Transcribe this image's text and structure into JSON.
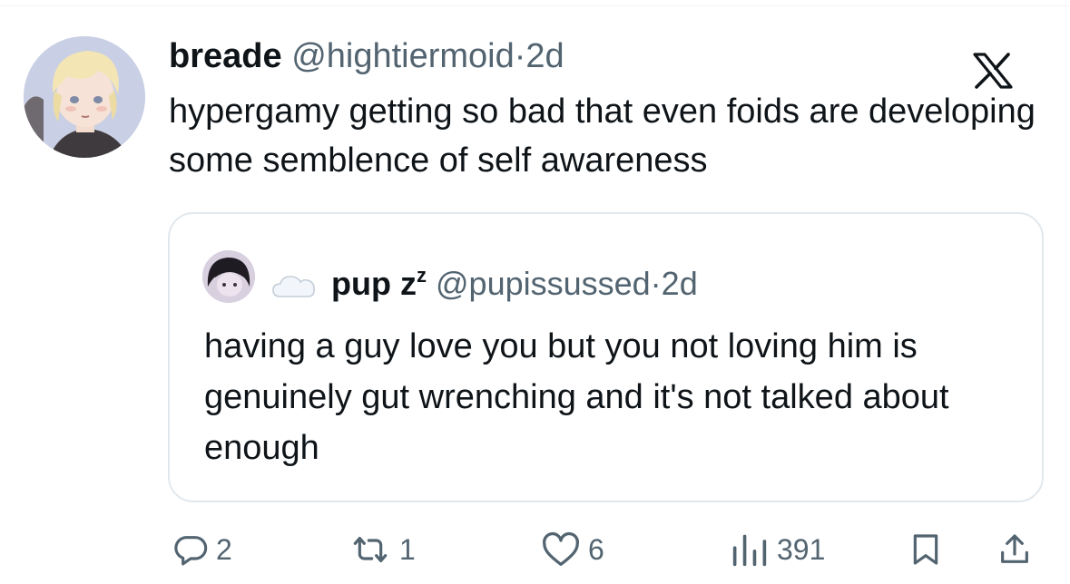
{
  "tweet": {
    "display_name": "breade",
    "handle": "@hightiermoid",
    "separator": "·",
    "time": "2d",
    "text": "hypergamy getting so bad that even foids are developing some semblence of self awareness",
    "logo_icon": "x-logo-icon"
  },
  "quote": {
    "display_name": "pup z",
    "name_sup": "z",
    "handle": "@pupissussed",
    "separator": "·",
    "time": "2d",
    "name_icon": "cloud-icon",
    "text": "having a guy love you but you not loving him is genuinely gut wrenching and it's not talked about enough"
  },
  "actions": {
    "replies": "2",
    "reposts": "1",
    "likes": "6",
    "views": "391",
    "icons": [
      "reply-icon",
      "repost-icon",
      "like-icon",
      "views-icon",
      "bookmark-icon",
      "share-icon"
    ]
  },
  "colors": {
    "text": "#0f1419",
    "secondary": "#536471",
    "border": "#e1e8ed"
  }
}
